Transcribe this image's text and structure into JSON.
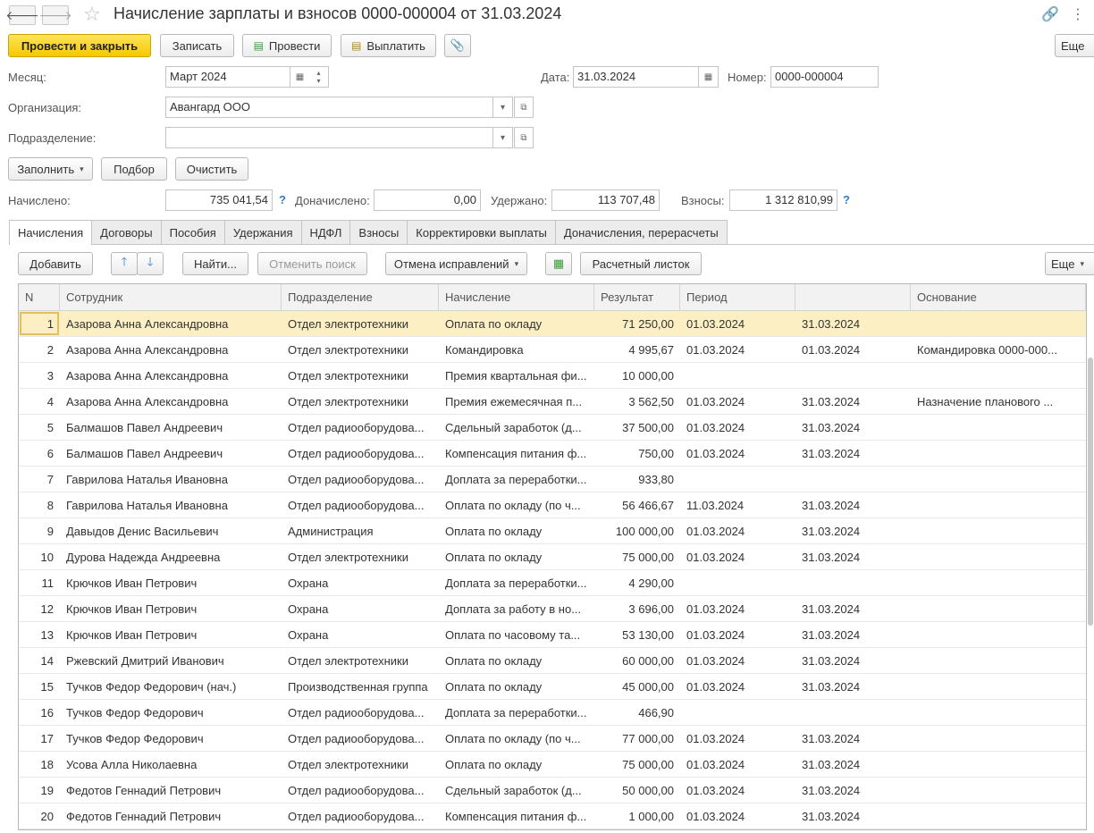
{
  "window": {
    "title": "Начисление зарплаты и взносов 0000-000004 от 31.03.2024",
    "back_icon": "arrow-left",
    "forward_icon": "arrow-right"
  },
  "toolbar": {
    "post_close": "Провести и закрыть",
    "save": "Записать",
    "post": "Провести",
    "pay": "Выплатить",
    "more": "Еще"
  },
  "form": {
    "month_label": "Месяц:",
    "month_value": "Март 2024",
    "date_label": "Дата:",
    "date_value": "31.03.2024",
    "number_label": "Номер:",
    "number_value": "0000-000004",
    "org_label": "Организация:",
    "org_value": "Авангард ООО",
    "dept_label": "Подразделение:",
    "dept_value": ""
  },
  "actions": {
    "fill": "Заполнить",
    "pick": "Подбор",
    "clear": "Очистить"
  },
  "totals": {
    "accrued_label": "Начислено:",
    "accrued": "735 041,54",
    "extra_label": "Доначислено:",
    "extra": "0,00",
    "withheld_label": "Удержано:",
    "withheld": "113 707,48",
    "contrib_label": "Взносы:",
    "contrib": "1 312 810,99",
    "help": "?"
  },
  "tabs": [
    "Начисления",
    "Договоры",
    "Пособия",
    "Удержания",
    "НДФЛ",
    "Взносы",
    "Корректировки выплаты",
    "Доначисления, перерасчеты"
  ],
  "grid_toolbar": {
    "add": "Добавить",
    "find": "Найти...",
    "cancel_search": "Отменить поиск",
    "undo_fix": "Отмена исправлений",
    "payslip": "Расчетный листок",
    "more": "Еще"
  },
  "table": {
    "columns": [
      "N",
      "Сотрудник",
      "Подразделение",
      "Начисление",
      "Результат",
      "Период",
      "",
      "Основание"
    ],
    "rows": [
      [
        "1",
        "Азарова Анна Александровна",
        "Отдел электротехники",
        "Оплата по окладу",
        "71 250,00",
        "01.03.2024",
        "31.03.2024",
        ""
      ],
      [
        "2",
        "Азарова Анна Александровна",
        "Отдел электротехники",
        "Командировка",
        "4 995,67",
        "01.03.2024",
        "01.03.2024",
        "Командировка 0000-000..."
      ],
      [
        "3",
        "Азарова Анна Александровна",
        "Отдел электротехники",
        "Премия квартальная фи...",
        "10 000,00",
        "",
        "",
        ""
      ],
      [
        "4",
        "Азарова Анна Александровна",
        "Отдел электротехники",
        "Премия ежемесячная п...",
        "3 562,50",
        "01.03.2024",
        "31.03.2024",
        "Назначение планового ..."
      ],
      [
        "5",
        "Балмашов Павел Андреевич",
        "Отдел радиооборудова...",
        "Сдельный заработок (д...",
        "37 500,00",
        "01.03.2024",
        "31.03.2024",
        ""
      ],
      [
        "6",
        "Балмашов Павел Андреевич",
        "Отдел радиооборудова...",
        "Компенсация питания ф...",
        "750,00",
        "01.03.2024",
        "31.03.2024",
        ""
      ],
      [
        "7",
        "Гаврилова Наталья Ивановна",
        "Отдел радиооборудова...",
        "Доплата за переработки...",
        "933,80",
        "",
        "",
        ""
      ],
      [
        "8",
        "Гаврилова Наталья Ивановна",
        "Отдел радиооборудова...",
        "Оплата по окладу (по ч...",
        "56 466,67",
        "11.03.2024",
        "31.03.2024",
        ""
      ],
      [
        "9",
        "Давыдов Денис Васильевич",
        "Администрация",
        "Оплата по окладу",
        "100 000,00",
        "01.03.2024",
        "31.03.2024",
        ""
      ],
      [
        "10",
        "Дурова Надежда Андреевна",
        "Отдел электротехники",
        "Оплата по окладу",
        "75 000,00",
        "01.03.2024",
        "31.03.2024",
        ""
      ],
      [
        "11",
        "Крючков Иван Петрович",
        "Охрана",
        "Доплата за переработки...",
        "4 290,00",
        "",
        "",
        ""
      ],
      [
        "12",
        "Крючков Иван Петрович",
        "Охрана",
        "Доплата за работу в но...",
        "3 696,00",
        "01.03.2024",
        "31.03.2024",
        ""
      ],
      [
        "13",
        "Крючков Иван Петрович",
        "Охрана",
        "Оплата по часовому та...",
        "53 130,00",
        "01.03.2024",
        "31.03.2024",
        ""
      ],
      [
        "14",
        "Ржевский Дмитрий Иванович",
        "Отдел электротехники",
        "Оплата по окладу",
        "60 000,00",
        "01.03.2024",
        "31.03.2024",
        ""
      ],
      [
        "15",
        "Тучков Федор Федорович (нач.)",
        "Производственная группа",
        "Оплата по окладу",
        "45 000,00",
        "01.03.2024",
        "31.03.2024",
        ""
      ],
      [
        "16",
        "Тучков Федор Федорович",
        "Отдел радиооборудова...",
        "Доплата за переработки...",
        "466,90",
        "",
        "",
        ""
      ],
      [
        "17",
        "Тучков Федор Федорович",
        "Отдел радиооборудова...",
        "Оплата по окладу (по ч...",
        "77 000,00",
        "01.03.2024",
        "31.03.2024",
        ""
      ],
      [
        "18",
        "Усова Алла Николаевна",
        "Отдел электротехники",
        "Оплата по окладу",
        "75 000,00",
        "01.03.2024",
        "31.03.2024",
        ""
      ],
      [
        "19",
        "Федотов Геннадий Петрович",
        "Отдел радиооборудова...",
        "Сдельный заработок (д...",
        "50 000,00",
        "01.03.2024",
        "31.03.2024",
        ""
      ],
      [
        "20",
        "Федотов Геннадий Петрович",
        "Отдел радиооборудова...",
        "Компенсация питания ф...",
        "1 000,00",
        "01.03.2024",
        "31.03.2024",
        ""
      ]
    ],
    "selected_row": 0
  },
  "colors": {
    "primary_button": "#f5c900",
    "selected_row": "#fbefc3",
    "help": "#2a7fd4"
  }
}
